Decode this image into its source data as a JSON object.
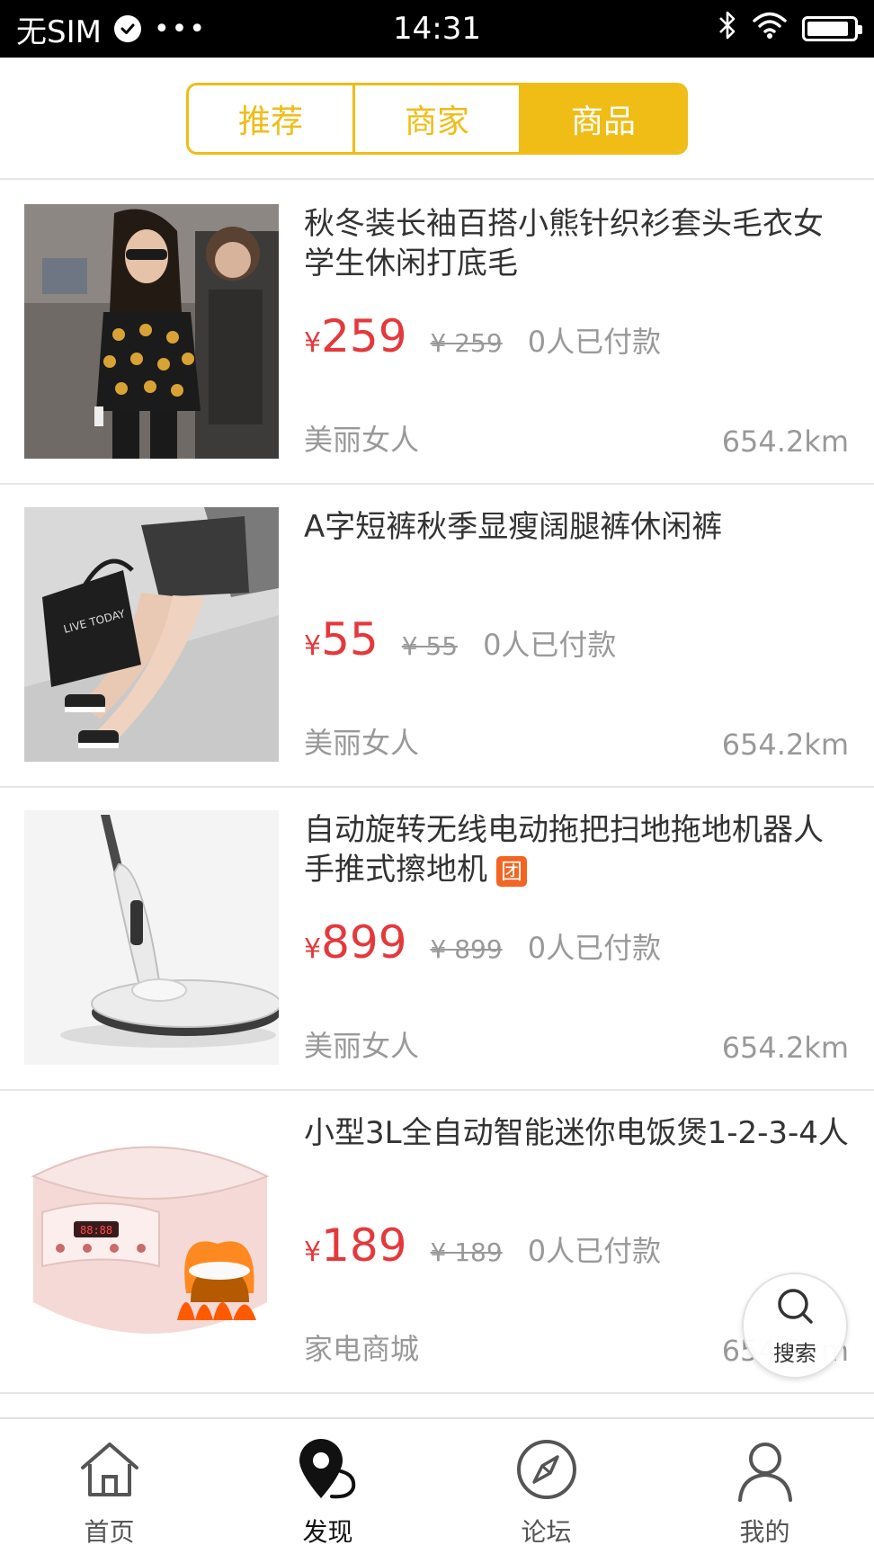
{
  "status_bar": {
    "carrier": "无SIM",
    "time": "14:31",
    "battery_level": 0.9
  },
  "tabs": [
    {
      "label": "推荐",
      "active": false
    },
    {
      "label": "商家",
      "active": false
    },
    {
      "label": "商品",
      "active": true
    }
  ],
  "products": [
    {
      "title": "秋冬装长袖百搭小熊针织衫套头毛衣女学生休闲打底毛",
      "price_symbol": "¥",
      "price": "259",
      "original_price": "¥ 259",
      "sold": "0人已付款",
      "shop": "美丽女人",
      "distance": "654.2km",
      "badge": ""
    },
    {
      "title": "A字短裤秋季显瘦阔腿裤休闲裤",
      "price_symbol": "¥",
      "price": "55",
      "original_price": "¥ 55",
      "sold": "0人已付款",
      "shop": "美丽女人",
      "distance": "654.2km",
      "badge": ""
    },
    {
      "title": "自动旋转无线电动拖把扫地拖地机器人手推式擦地机",
      "price_symbol": "¥",
      "price": "899",
      "original_price": "¥ 899",
      "sold": "0人已付款",
      "shop": "美丽女人",
      "distance": "654.2km",
      "badge": "团"
    },
    {
      "title": "小型3L全自动智能迷你电饭煲1-2-3-4人",
      "price_symbol": "¥",
      "price": "189",
      "original_price": "¥ 189",
      "sold": "0人已付款",
      "shop": "家电商城",
      "distance": "654.2km",
      "badge": ""
    }
  ],
  "float_search": {
    "label": "搜索",
    "icon": "search-icon"
  },
  "bottom_nav": [
    {
      "label": "首页",
      "icon": "home-icon",
      "active": false
    },
    {
      "label": "发现",
      "icon": "location-pin-icon",
      "active": true
    },
    {
      "label": "论坛",
      "icon": "compass-icon",
      "active": false
    },
    {
      "label": "我的",
      "icon": "person-icon",
      "active": false
    }
  ],
  "colors": {
    "accent": "#f0bc16",
    "price": "#e4393c",
    "badge": "#f26522",
    "muted": "#999999"
  }
}
